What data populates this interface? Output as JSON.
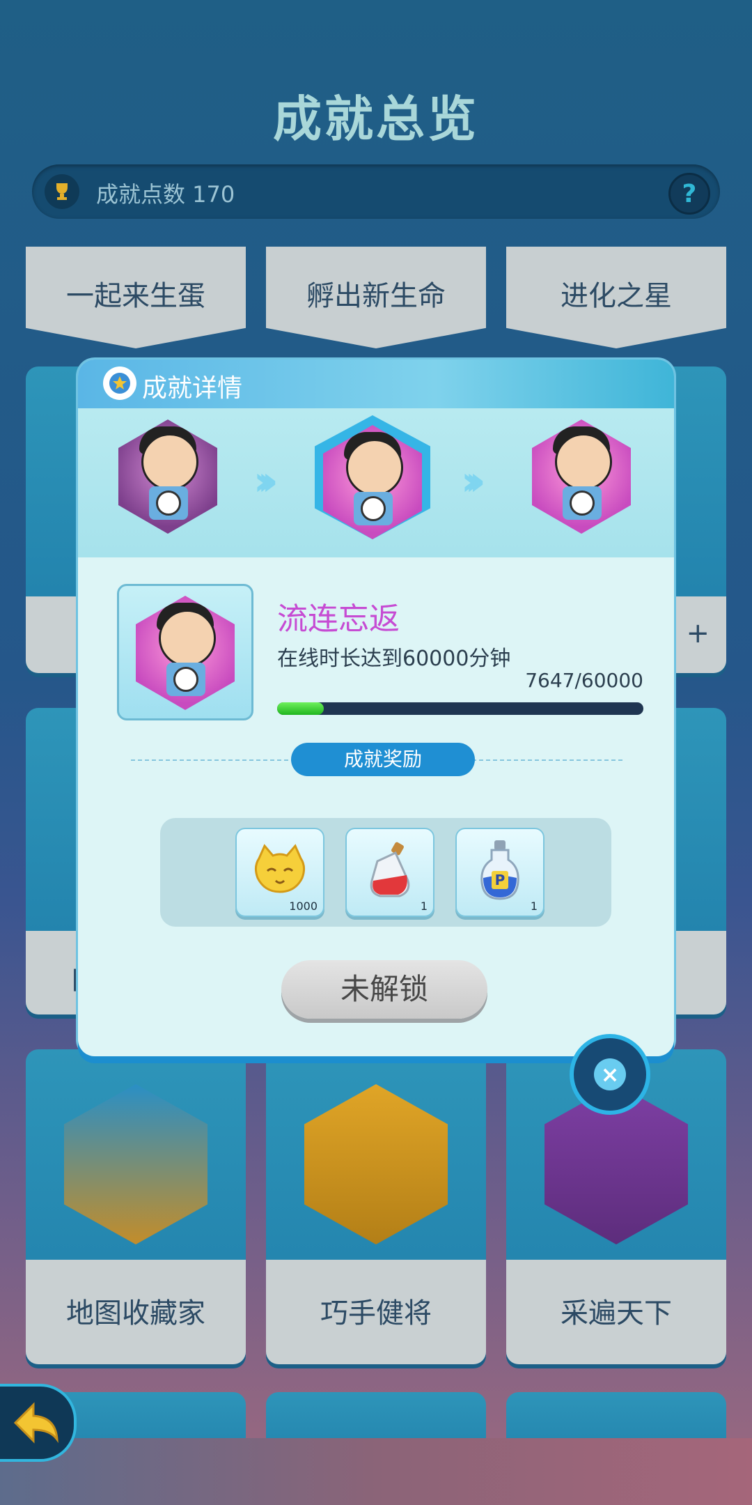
{
  "page_title": "成就总览",
  "points_bar": {
    "label": "成就点数 170",
    "help_icon": "?"
  },
  "top_row": [
    "一起来生蛋",
    "孵出新生命",
    "进化之星"
  ],
  "bottom_row": [
    "地图收藏家",
    "巧手健将",
    "采遍天下"
  ],
  "side_peek": {
    "left_text": "口",
    "right_text": "+"
  },
  "modal": {
    "title": "成就详情",
    "achievement_name": "流连忘返",
    "description": "在线时长达到60000分钟",
    "progress_text": "7647/60000",
    "progress_fraction": 0.127,
    "reward_title": "成就奖励",
    "rewards": [
      {
        "icon": "cat-coin-icon",
        "count": "1000"
      },
      {
        "icon": "red-potion-icon",
        "count": "1"
      },
      {
        "icon": "blue-p-potion-icon",
        "count": "1"
      }
    ],
    "unlock_button": "未解锁"
  },
  "colors": {
    "accent": "#1f8fd3",
    "achievement_name": "#c64bd3",
    "progress_fill": "#2bc127"
  }
}
